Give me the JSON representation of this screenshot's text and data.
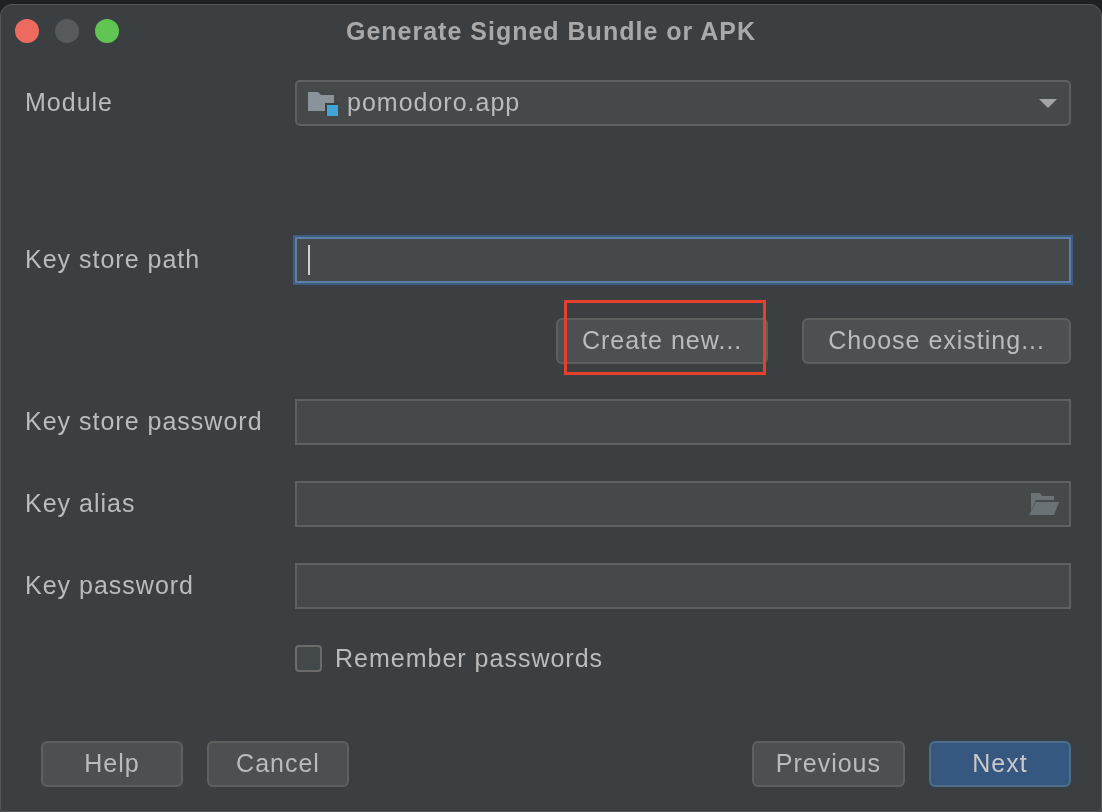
{
  "window": {
    "title": "Generate Signed Bundle or APK"
  },
  "module": {
    "label": "Module",
    "value": "pomodoro.app"
  },
  "key_store_path": {
    "label": "Key store path",
    "focused": true
  },
  "key_store_buttons": [
    {
      "label": "Create new...",
      "highlighted": true
    },
    {
      "label": "Choose existing...",
      "highlighted": false
    }
  ],
  "fields": [
    {
      "label": "Key store password",
      "kind": "text"
    },
    {
      "label": "Key alias",
      "kind": "browse"
    },
    {
      "label": "Key password",
      "kind": "text"
    }
  ],
  "remember_passwords": {
    "label": "Remember passwords",
    "checked": false
  },
  "footer": {
    "left_buttons": [
      {
        "label": "Help",
        "primary": false
      },
      {
        "label": "Cancel",
        "primary": false
      }
    ],
    "right_buttons": [
      {
        "label": "Previous",
        "primary": false
      },
      {
        "label": "Next",
        "primary": true
      }
    ]
  }
}
